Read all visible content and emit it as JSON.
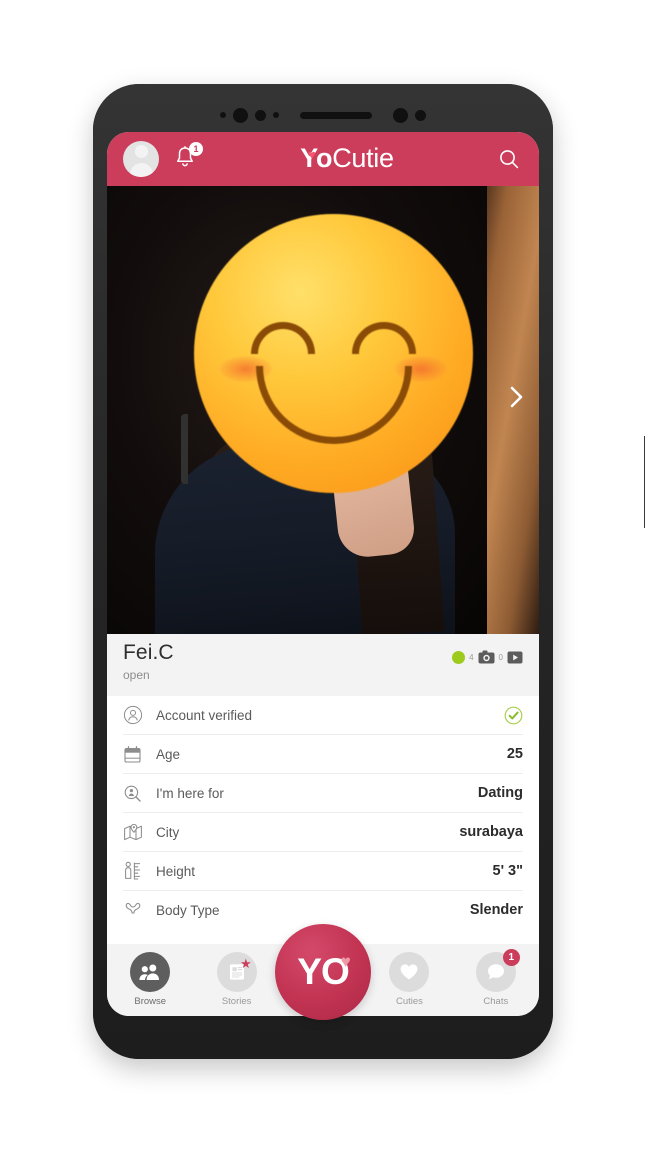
{
  "header": {
    "brand_yo": "Y",
    "brand_o": "o",
    "brand_rest": "Cutie",
    "notification_badge": "1",
    "avatar_icon": "user-avatar-icon",
    "bell_icon": "bell-icon",
    "search_icon": "search-icon",
    "brand_heart_icon": "heart-icon",
    "accent_color": "#cc3d5c"
  },
  "photo": {
    "next_arrow_icon": "chevron-right-icon",
    "emoji_icon": "smiling-face-emoji"
  },
  "profile": {
    "name": "Fei.C",
    "status": "open",
    "online_indicator": "online-dot",
    "photo_count": "4",
    "photo_icon": "camera-icon",
    "video_count": "0",
    "video_icon": "video-icon",
    "online_color": "#9ccb1e"
  },
  "details": [
    {
      "icon": "account-verified-icon",
      "label": "Account verified",
      "value": "",
      "check": "check-circle-icon"
    },
    {
      "icon": "calendar-icon",
      "label": "Age",
      "value": "25",
      "check": ""
    },
    {
      "icon": "search-person-icon",
      "label": "I'm here for",
      "value": "Dating",
      "check": ""
    },
    {
      "icon": "map-location-icon",
      "label": "City",
      "value": "surabaya",
      "check": ""
    },
    {
      "icon": "height-ruler-icon",
      "label": "Height",
      "value": "5' 3\"",
      "check": ""
    },
    {
      "icon": "body-type-icon",
      "label": "Body Type",
      "value": "Slender",
      "check": ""
    }
  ],
  "nav": {
    "items": [
      {
        "label": "Browse",
        "icon": "people-icon",
        "badge": "",
        "active": true
      },
      {
        "label": "Stories",
        "icon": "stories-icon",
        "badge": "",
        "active": false
      },
      {
        "label": "Cuties",
        "icon": "heart-icon",
        "badge": "",
        "active": false
      },
      {
        "label": "Chats",
        "icon": "chat-bubble-icon",
        "badge": "1",
        "active": false
      }
    ],
    "center_button": {
      "label": "YO",
      "y_text": "Y",
      "o_text": "O",
      "heart_icon": "heart-icon",
      "color": "#c33453"
    }
  }
}
